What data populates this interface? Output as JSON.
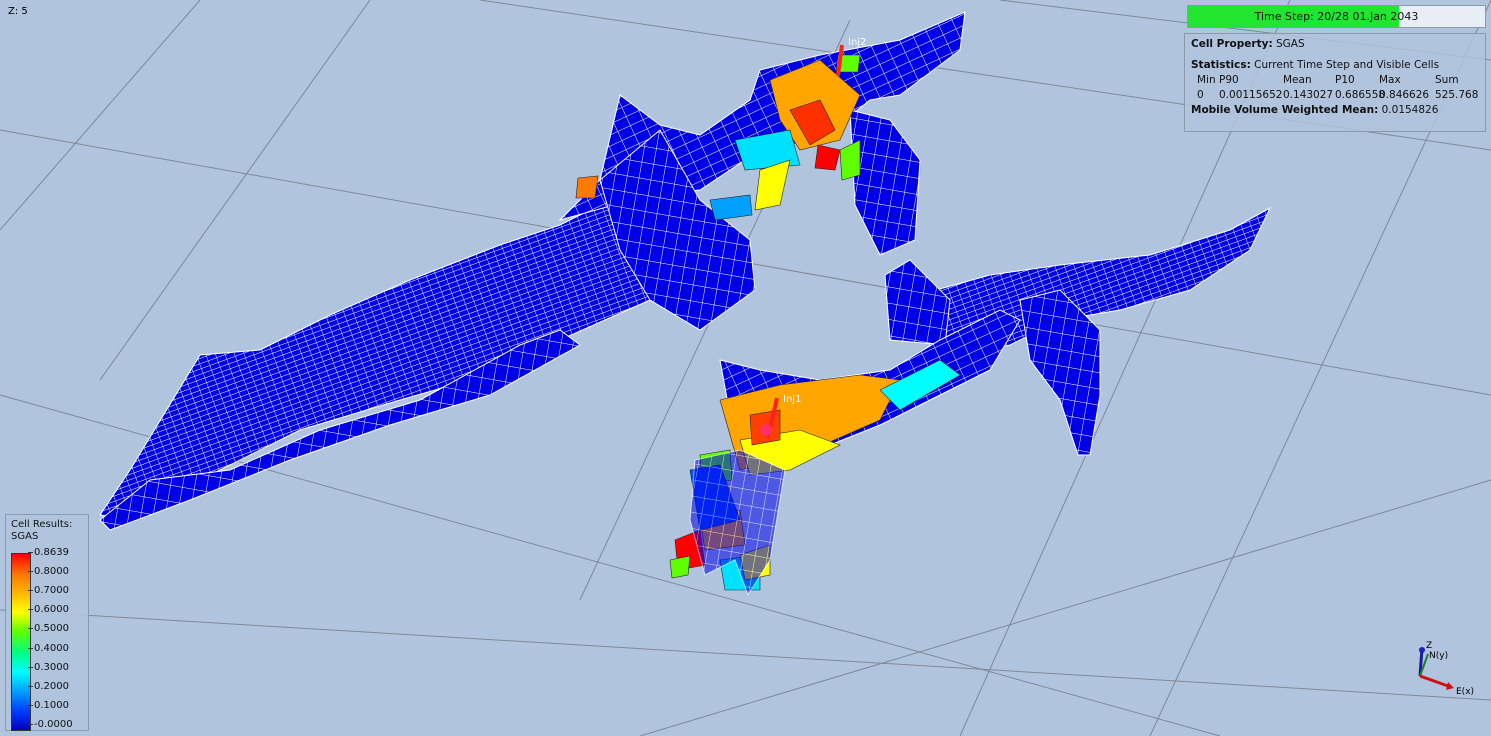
{
  "view": {
    "z_scale": "Z: 5",
    "background_color": "#b0c4de",
    "well_labels": [
      "Inj2",
      "Inj1"
    ]
  },
  "time_step": {
    "label": "Time Step: 20/28 01.Jan 2043",
    "progress": 0.71,
    "bar_color": "#22e532"
  },
  "info": {
    "cell_property_label": "Cell Property:",
    "cell_property_value": "SGAS",
    "statistics_label": "Statistics:",
    "statistics_value": "Current Time Step and Visible Cells",
    "stats_headers": [
      "Min",
      "P90",
      "Mean",
      "P10",
      "Max",
      "Sum"
    ],
    "stats_values": [
      "0",
      "0.00115652",
      "0.143027",
      "0.686558",
      "0.846626",
      "525.768"
    ],
    "mobile_label": "Mobile Volume Weighted Mean:",
    "mobile_value": "0.0154826"
  },
  "legend": {
    "title_line1": "Cell Results:",
    "title_line2": "SGAS",
    "ticks": [
      "0.8639",
      "0.8000",
      "0.7000",
      "0.6000",
      "0.5000",
      "0.4000",
      "0.3000",
      "0.2000",
      "0.1000",
      "-0.0000"
    ]
  },
  "axes": {
    "z_label": "Z",
    "n_label": "N(y)",
    "e_label": "E(x)"
  }
}
